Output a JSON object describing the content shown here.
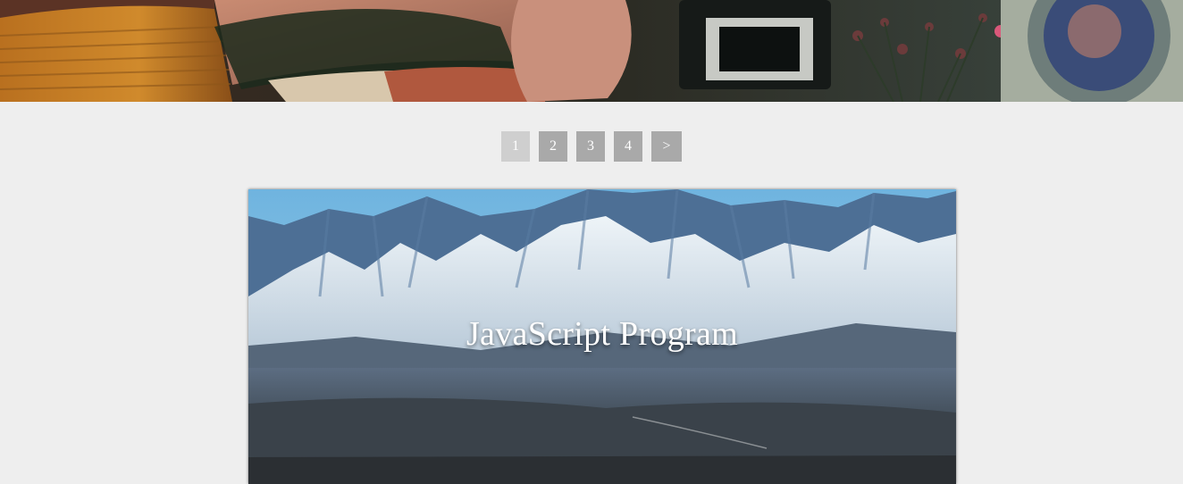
{
  "pagination": {
    "pages": [
      "1",
      "2",
      "3",
      "4"
    ],
    "active_page": "1",
    "next_label": ">"
  },
  "post": {
    "title": "JavaScript Program"
  },
  "colors": {
    "page_background": "#eeeeee",
    "page_button": "#a9a9a9",
    "page_button_active": "#cfcfcf",
    "button_text": "#ffffff"
  }
}
